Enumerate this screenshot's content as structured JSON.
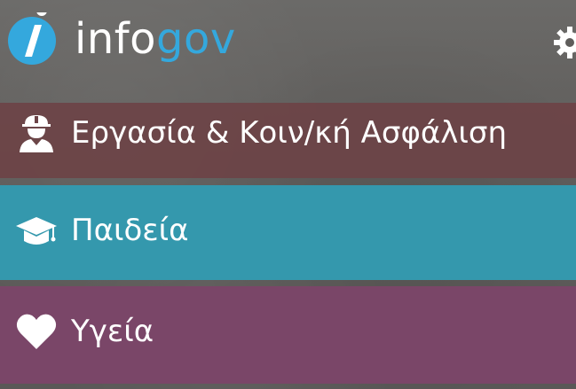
{
  "app": {
    "logo_text_1": "info",
    "logo_text_2": "gov",
    "colors": {
      "brand_blue": "#34a8dd",
      "work_bg": "#6c4347",
      "edu_bg": "#3498ad",
      "health_bg": "#7a4668"
    }
  },
  "header": {
    "logo_icon": "info-i-icon",
    "settings_icon": "gear-icon"
  },
  "menu": {
    "items": [
      {
        "label": "Εργασία & Κοιν/κή Ασφάλιση",
        "icon": "worker-icon"
      },
      {
        "label": "Παιδεία",
        "icon": "graduation-cap-icon"
      },
      {
        "label": "Υγεία",
        "icon": "heart-icon"
      }
    ]
  }
}
